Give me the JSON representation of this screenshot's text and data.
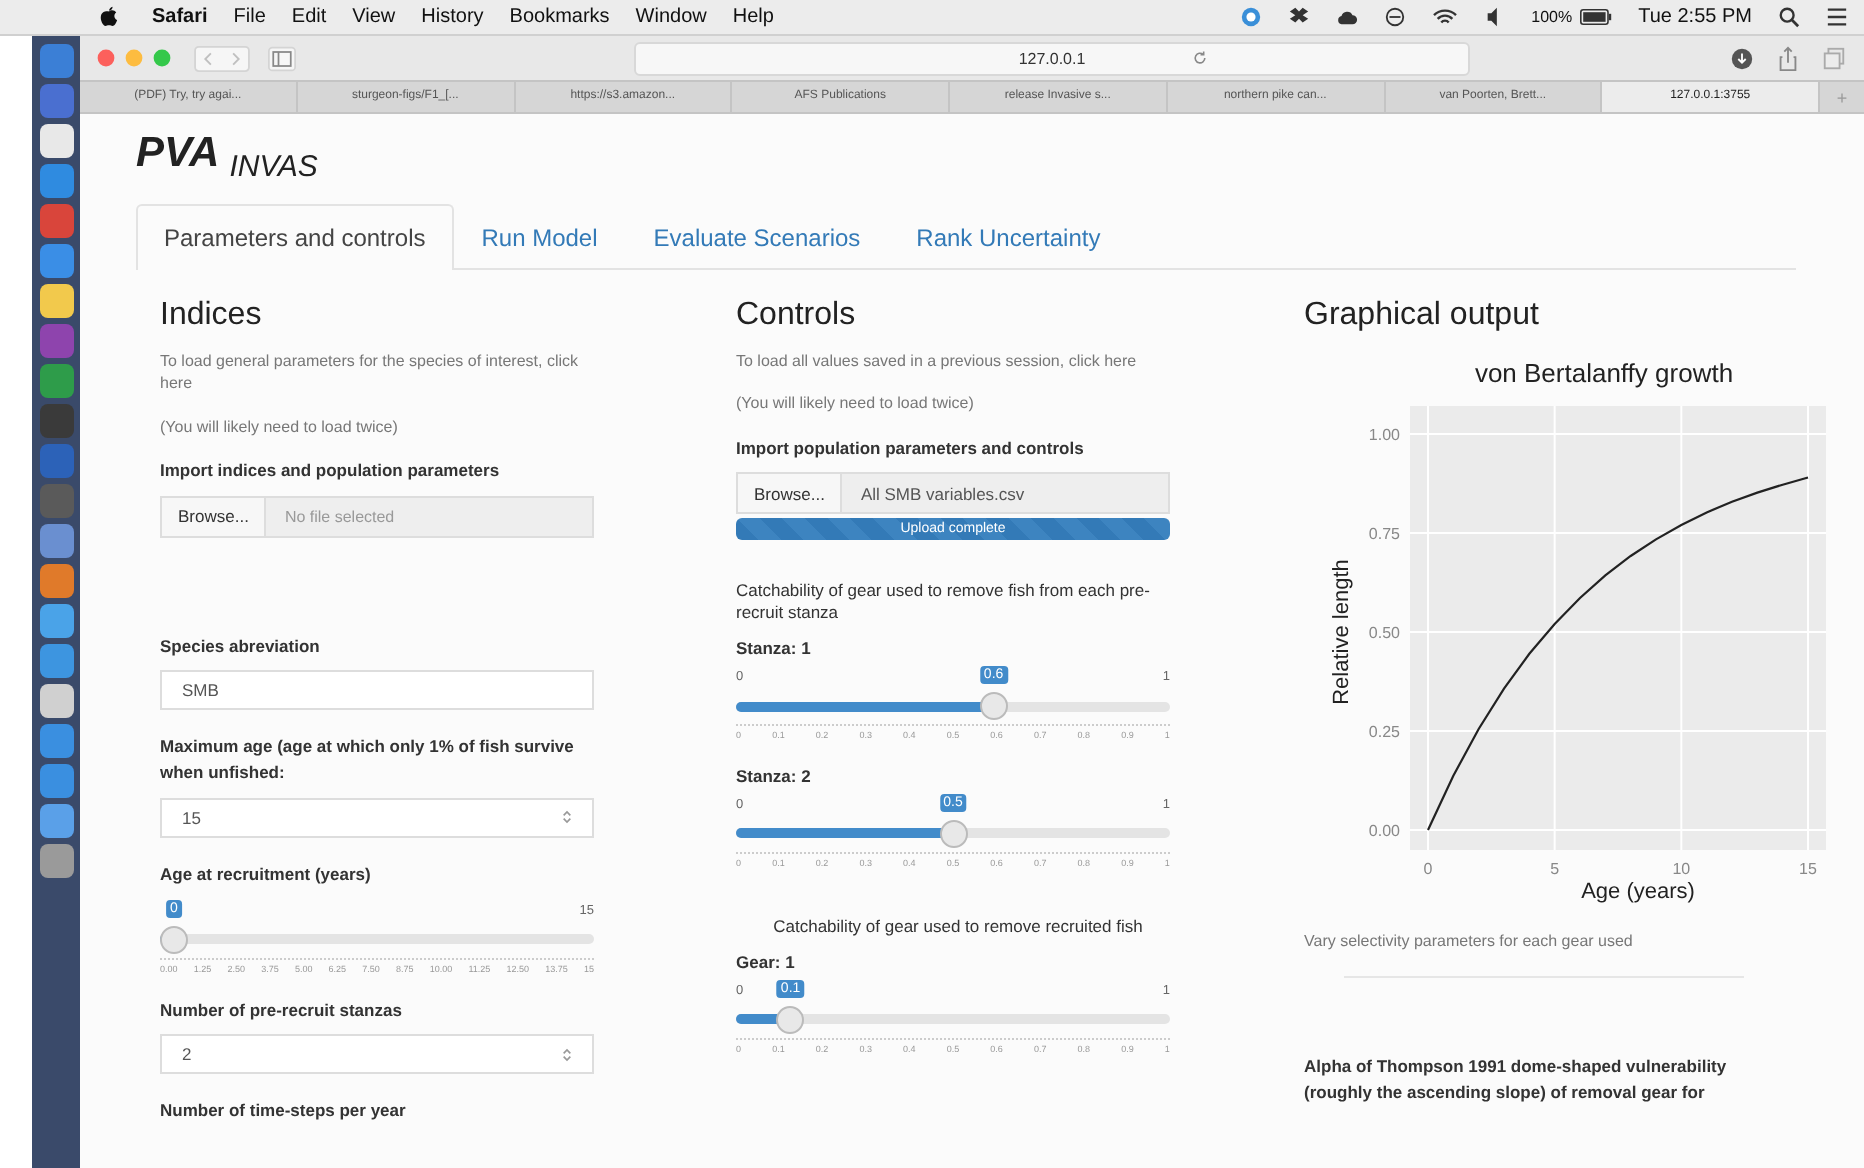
{
  "menu_bar": {
    "app": "Safari",
    "items": [
      "File",
      "Edit",
      "View",
      "History",
      "Bookmarks",
      "Window",
      "Help"
    ],
    "battery": "100%",
    "clock": "Tue 2:55 PM"
  },
  "browser": {
    "address": "127.0.0.1",
    "tabs": [
      {
        "label": "(PDF) Try, try agai...",
        "selected": false
      },
      {
        "label": "sturgeon-figs/F1_[...",
        "selected": false
      },
      {
        "label": "https://s3.amazon...",
        "selected": false
      },
      {
        "label": "AFS Publications",
        "selected": false
      },
      {
        "label": "release Invasive s...",
        "selected": false
      },
      {
        "label": "northern pike can...",
        "selected": false
      },
      {
        "label": "van Poorten, Brett...",
        "selected": false
      },
      {
        "label": "127.0.0.1:3755",
        "selected": true
      }
    ],
    "new_tab": "+"
  },
  "app_title": "PVA $_{INVAS}$",
  "nav_tabs": [
    {
      "label": "Parameters and controls",
      "selected": true
    },
    {
      "label": "Run Model",
      "selected": false
    },
    {
      "label": "Evaluate Scenarios",
      "selected": false
    },
    {
      "label": "Rank Uncertainty",
      "selected": false
    }
  ],
  "indices": {
    "heading": "Indices",
    "description": "To load general parameters for the species of interest, click here",
    "note": "(You will likely need to load twice)",
    "import_label": "Import indices and population parameters",
    "browse": "Browse...",
    "file": "No file selected",
    "fields": [
      {
        "kind": "text",
        "label": "Species abreviation",
        "value": "SMB"
      },
      {
        "kind": "number",
        "label": "Maximum age (age at which only 1% of fish survive when unfished:",
        "value": "15"
      },
      {
        "kind": "slider",
        "label": "Age at recruitment (years)",
        "value": "0",
        "max": "15",
        "level": 0,
        "ticks": [
          "0.00",
          "1.25",
          "2.50",
          "3.75",
          "5.00",
          "6.25",
          "7.50",
          "8.75",
          "10.00",
          "11.25",
          "12.50",
          "13.75",
          "15"
        ]
      },
      {
        "kind": "number",
        "label": "Number of pre-recruit stanzas",
        "value": "2"
      },
      {
        "kind": "label",
        "label": "Number of time-steps per year"
      }
    ]
  },
  "controls": {
    "heading": "Controls",
    "description": "To load all values saved in a previous session, click here",
    "note": "(You will likely need to load twice)",
    "import_label": "Import population parameters and controls",
    "browse": "Browse...",
    "file": "All SMB variables.csv",
    "upload": {
      "text": "Upload complete",
      "level": 1
    },
    "groups": [
      {
        "title": "Catchability of gear used to remove fish from each pre-recruit stanza",
        "sliders": [
          {
            "label": "Stanza: 1",
            "min": "0",
            "max": "1",
            "value": "0.6",
            "level": 0.6,
            "ticks": [
              "0",
              "0.1",
              "0.2",
              "0.3",
              "0.4",
              "0.5",
              "0.6",
              "0.7",
              "0.8",
              "0.9",
              "1"
            ]
          },
          {
            "label": "Stanza: 2",
            "min": "0",
            "max": "1",
            "value": "0.5",
            "level": 0.5,
            "ticks": [
              "0",
              "0.1",
              "0.2",
              "0.3",
              "0.4",
              "0.5",
              "0.6",
              "0.7",
              "0.8",
              "0.9",
              "1"
            ]
          }
        ]
      },
      {
        "title": "Catchability of gear used to remove recruited fish",
        "sliders": [
          {
            "label": "Gear: 1",
            "min": "0",
            "max": "1",
            "value": "0.1",
            "level": 0.1,
            "ticks": [
              "0",
              "0.1",
              "0.2",
              "0.3",
              "0.4",
              "0.5",
              "0.6",
              "0.7",
              "0.8",
              "0.9",
              "1"
            ]
          }
        ]
      }
    ]
  },
  "graphical_output": {
    "heading": "Graphical output",
    "chart_data": {
      "type": "line",
      "title": "von Bertalanffy growth",
      "xlabel": "Age (years)",
      "ylabel": "Relative length",
      "x": [
        0,
        1,
        2,
        3,
        4,
        5,
        6,
        7,
        8,
        9,
        10,
        11,
        12,
        13,
        14,
        15
      ],
      "grid": true,
      "series": [
        {
          "color": "#222222",
          "values": [
            0,
            0.137,
            0.255,
            0.357,
            0.445,
            0.52,
            0.586,
            0.643,
            0.692,
            0.734,
            0.77,
            0.802,
            0.829,
            0.852,
            0.872,
            0.89
          ]
        }
      ],
      "xlim": [
        0,
        15
      ],
      "ylim": [
        0,
        1
      ],
      "xticks": [
        0,
        5,
        10,
        15
      ],
      "yticks": [
        {
          "value": 0,
          "label": "0.00"
        },
        {
          "value": 0.25,
          "label": "0.25"
        },
        {
          "value": 0.5,
          "label": "0.50"
        },
        {
          "value": 0.75,
          "label": "0.75"
        },
        {
          "value": 1,
          "label": "1.00"
        }
      ]
    },
    "note": "Vary selectivity parameters for each gear used",
    "alpha_label": "Alpha of Thompson 1991 dome-shaped vulnerability (roughly the ascending slope) of removal gear for"
  }
}
